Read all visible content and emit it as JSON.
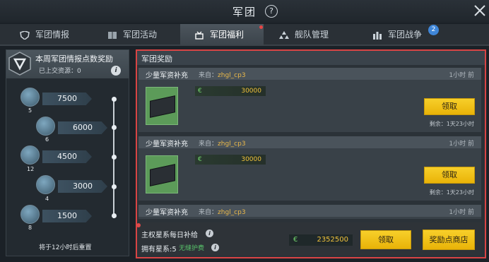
{
  "window": {
    "title": "军团",
    "help_glyph": "?"
  },
  "tabs": [
    {
      "label": "军团情报",
      "icon": "shield-icon"
    },
    {
      "label": "军团活动",
      "icon": "book-icon"
    },
    {
      "label": "军团福利",
      "icon": "gift-icon",
      "active": true
    },
    {
      "label": "舰队管理",
      "icon": "fleet-icon"
    },
    {
      "label": "军团战争",
      "icon": "castle-icon",
      "badge": "2"
    }
  ],
  "left_panel": {
    "title": "本周军团情报点数奖励",
    "submitted_label": "已上交资源：0",
    "info_glyph": "i",
    "rewards": [
      {
        "points": "7500",
        "level": "5"
      },
      {
        "points": "6000",
        "level": "6"
      },
      {
        "points": "4500",
        "level": "12"
      },
      {
        "points": "3000",
        "level": "4"
      },
      {
        "points": "1500",
        "level": "8"
      }
    ],
    "reset_text": "将于12小时后重置"
  },
  "right_panel": {
    "title": "军团奖励",
    "cards": [
      {
        "name": "少量军资补充",
        "from_label": "来自：",
        "from_value": "zhgl_cp3",
        "time": "1小时 前",
        "currency_glyph": "€",
        "amount": "30000",
        "button": "领取",
        "remaining": "剩余：1天23小时"
      },
      {
        "name": "少量军资补充",
        "from_label": "来自：",
        "from_value": "zhgl_cp3",
        "time": "1小时 前",
        "currency_glyph": "€",
        "amount": "30000",
        "button": "领取",
        "remaining": "剩余：1天23小时"
      },
      {
        "name": "少量军资补充",
        "from_label": "来自：",
        "from_value": "zhgl_cp3",
        "time": "1小时 前"
      }
    ],
    "daily": {
      "label": "主权星系每日补给",
      "stars_label": "拥有星系:5",
      "no_protection": "无缝护费",
      "currency_glyph": "€",
      "amount": "2352500",
      "claim_button": "领取",
      "shop_button": "奖励点商店"
    }
  },
  "colors": {
    "accent_yellow": "#f2c21a",
    "highlight_red": "#d94444",
    "amount_gold": "#f2c33a"
  }
}
